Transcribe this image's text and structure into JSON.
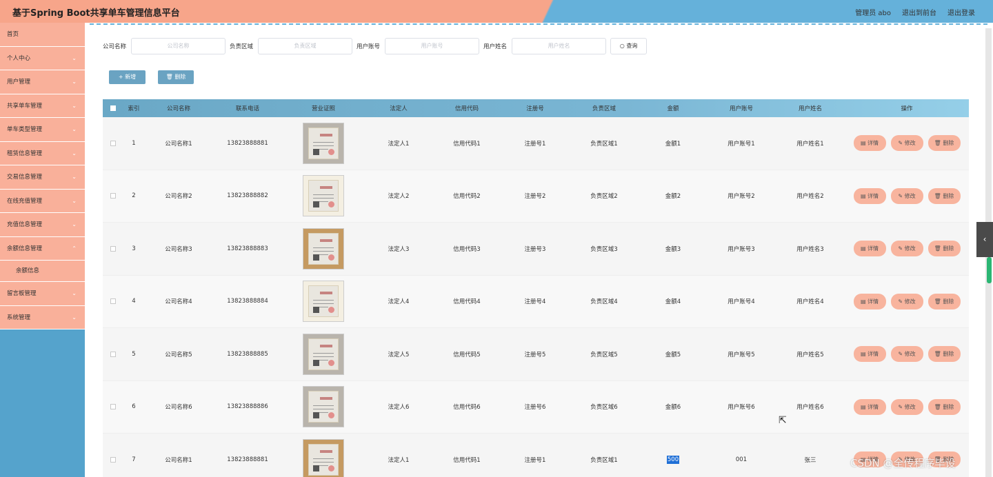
{
  "header": {
    "title": "基于Spring Boot共享单车管理信息平台",
    "admin": "管理员 abo",
    "back_front": "退出到前台",
    "logout": "退出登录"
  },
  "sidebar": {
    "items": [
      {
        "label": "首页"
      },
      {
        "label": "个人中心"
      },
      {
        "label": "用户管理"
      },
      {
        "label": "共享单车管理"
      },
      {
        "label": "单车类型管理"
      },
      {
        "label": "租赁信息管理"
      },
      {
        "label": "交易信息管理"
      },
      {
        "label": "在线充值管理"
      },
      {
        "label": "充值信息管理"
      },
      {
        "label": "余额信息管理"
      },
      {
        "label": "余额信息"
      },
      {
        "label": "留言板管理"
      },
      {
        "label": "系统管理"
      }
    ]
  },
  "search": {
    "company_label": "公司名称",
    "company_placeholder": "公司名称",
    "area_label": "负责区域",
    "area_placeholder": "负责区域",
    "account_label": "用户账号",
    "account_placeholder": "用户账号",
    "uname_label": "用户姓名",
    "uname_placeholder": "用户姓名",
    "query": "查询"
  },
  "actions": {
    "add": "新增",
    "delete": "删除"
  },
  "table": {
    "headers": [
      "索引",
      "公司名称",
      "联系电话",
      "营业证照",
      "法定人",
      "信用代码",
      "注册号",
      "负责区域",
      "金额",
      "用户账号",
      "用户姓名",
      "操作"
    ],
    "ops": {
      "detail": "详情",
      "edit": "修改",
      "delete": "删除"
    },
    "rows": [
      {
        "idx": "1",
        "name": "公司名称1",
        "tel": "13823888881",
        "legal": "法定人1",
        "credit": "信用代码1",
        "reg": "注册号1",
        "area": "负责区域1",
        "amount": "金额1",
        "account": "用户账号1",
        "uname": "用户姓名1"
      },
      {
        "idx": "2",
        "name": "公司名称2",
        "tel": "13823888882",
        "legal": "法定人2",
        "credit": "信用代码2",
        "reg": "注册号2",
        "area": "负责区域2",
        "amount": "金额2",
        "account": "用户账号2",
        "uname": "用户姓名2"
      },
      {
        "idx": "3",
        "name": "公司名称3",
        "tel": "13823888883",
        "legal": "法定人3",
        "credit": "信用代码3",
        "reg": "注册号3",
        "area": "负责区域3",
        "amount": "金额3",
        "account": "用户账号3",
        "uname": "用户姓名3"
      },
      {
        "idx": "4",
        "name": "公司名称4",
        "tel": "13823888884",
        "legal": "法定人4",
        "credit": "信用代码4",
        "reg": "注册号4",
        "area": "负责区域4",
        "amount": "金额4",
        "account": "用户账号4",
        "uname": "用户姓名4"
      },
      {
        "idx": "5",
        "name": "公司名称5",
        "tel": "13823888885",
        "legal": "法定人5",
        "credit": "信用代码5",
        "reg": "注册号5",
        "area": "负责区域5",
        "amount": "金额5",
        "account": "用户账号5",
        "uname": "用户姓名5"
      },
      {
        "idx": "6",
        "name": "公司名称6",
        "tel": "13823888886",
        "legal": "法定人6",
        "credit": "信用代码6",
        "reg": "注册号6",
        "area": "负责区域6",
        "amount": "金额6",
        "account": "用户账号6",
        "uname": "用户姓名6"
      },
      {
        "idx": "7",
        "name": "公司名称1",
        "tel": "13823888881",
        "legal": "法定人1",
        "credit": "信用代码1",
        "reg": "注册号1",
        "area": "负责区域1",
        "amount": "500",
        "account": "001",
        "uname": "张三"
      }
    ]
  },
  "watermark": "CSDN @全传程序毕设",
  "colors": {
    "accent_peach": "#f9b09a",
    "accent_blue": "#65b1da"
  }
}
